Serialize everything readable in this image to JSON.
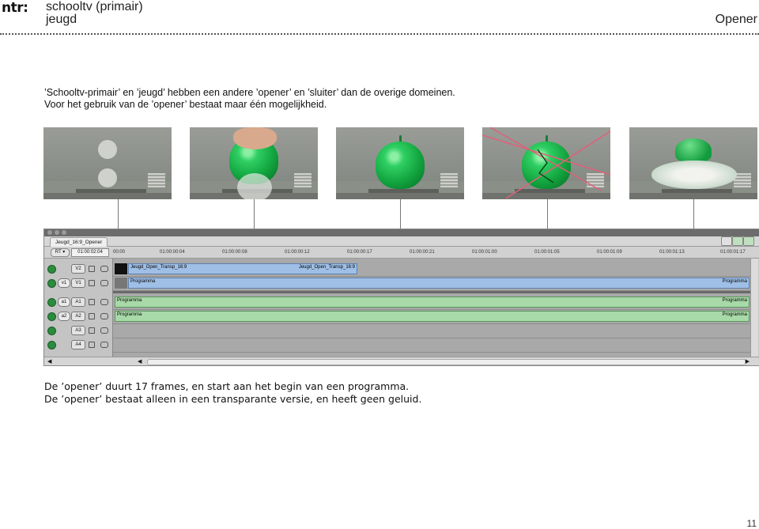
{
  "header": {
    "logo": "ntr:",
    "brand_line1": "schooltv (primair)",
    "brand_line2": "jeugd",
    "section_title": "Opener"
  },
  "intro": {
    "line1": "’Schooltv-primair’ en ’jeugd’ hebben een andere ’opener’ en ’sluiter’ dan de overige domeinen.",
    "line2": "Voor het gebruik van de ’opener’ bestaat maar één mogelijkheid."
  },
  "timeline": {
    "tab": "Jeugd_16:9_Opener",
    "rt": "RT ▾",
    "timecode": "01:00:02:04",
    "ticks": [
      "00:00",
      "01:00:00:04",
      "01:00:00:08",
      "01:00:00:12",
      "01:00:00:17",
      "01:00:00:21",
      "01:00:01:00",
      "01:00:01:05",
      "01:00:01:09",
      "01:00:01:13",
      "01:00:01:17"
    ],
    "tracks": [
      {
        "src": "",
        "dst": "V2"
      },
      {
        "src": "v1",
        "dst": "V1"
      },
      {
        "src": "a1",
        "dst": "A1"
      },
      {
        "src": "a2",
        "dst": "A2"
      },
      {
        "src": "",
        "dst": "A3"
      },
      {
        "src": "",
        "dst": "A4"
      }
    ],
    "clip_v2_a": "Jeugd_Open_Transp_16:9",
    "clip_v2_b": "Jeugd_Open_Transp_16:9",
    "clip_prog": "Programma"
  },
  "outro": {
    "line1": "De ’opener’ duurt 17 frames, en start aan het begin van een programma.",
    "line2": "De ’opener’ bestaat alleen in een transparante versie, en heeft geen geluid."
  },
  "page_number": "11"
}
